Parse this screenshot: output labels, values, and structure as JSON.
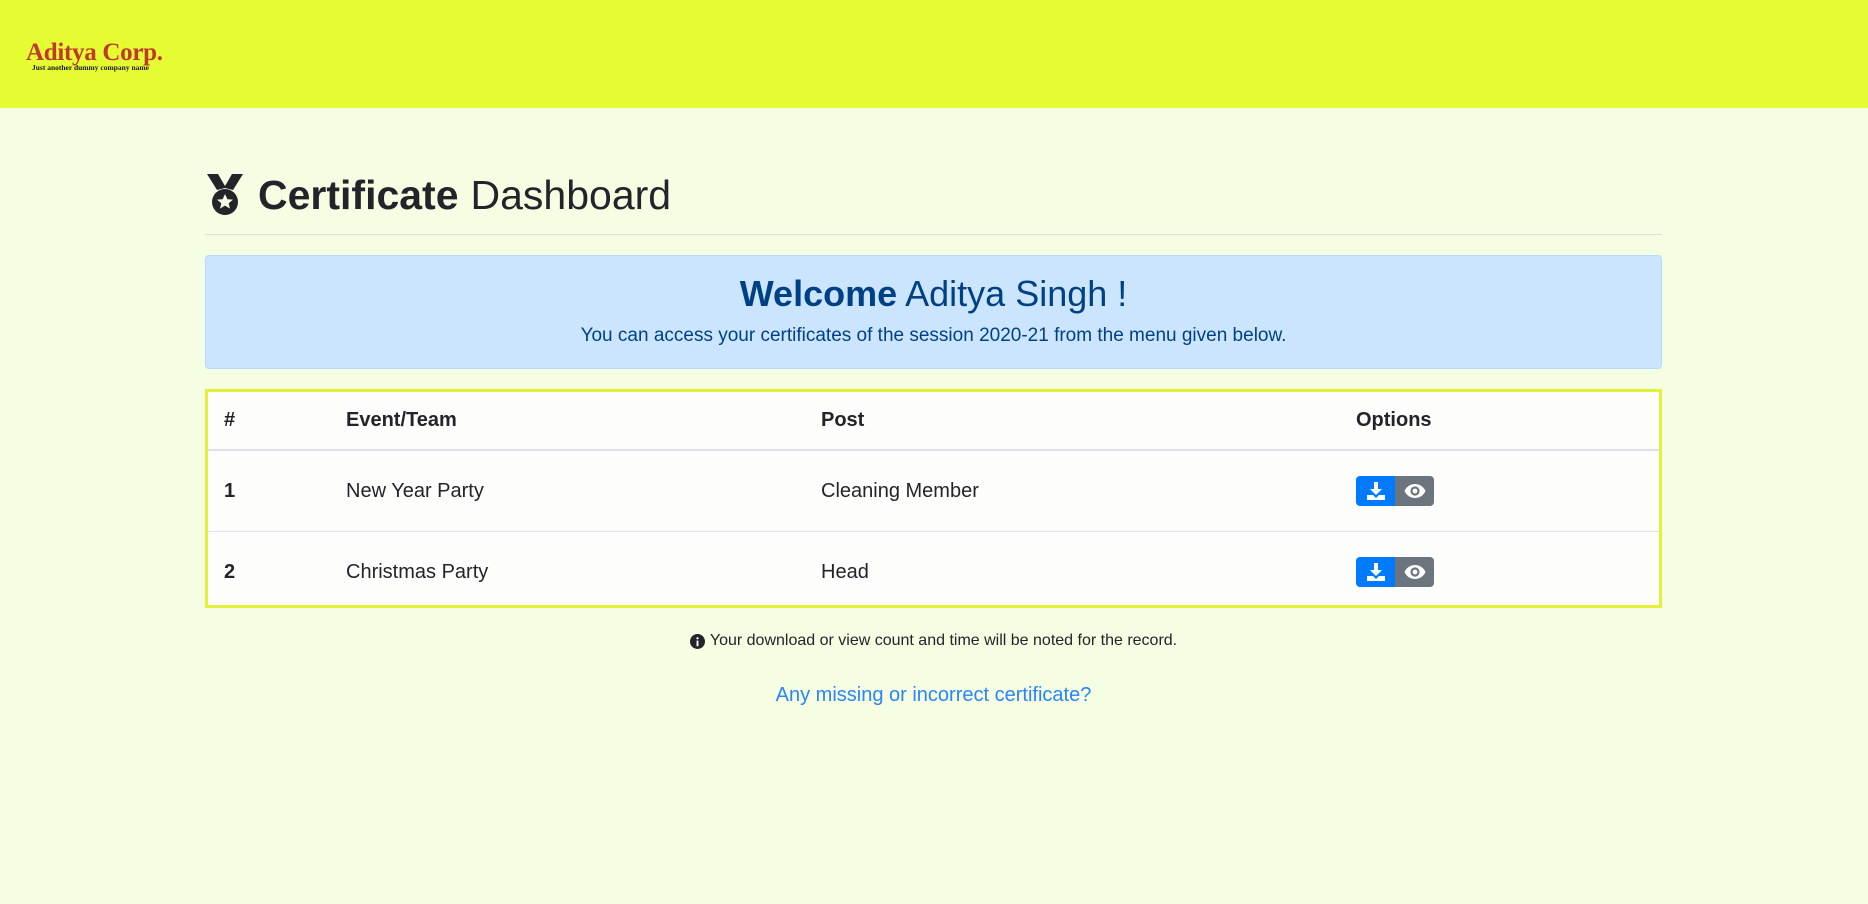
{
  "brand": {
    "name": "Aditya Corp.",
    "tagline": "Just another dummy company name"
  },
  "page": {
    "title_bold": "Certificate",
    "title_rest": "Dashboard",
    "icon": "medal-icon"
  },
  "welcome": {
    "greeting": "Welcome",
    "user_name": "Aditya Singh !",
    "message": "You can access your certificates of the session 2020-21 from the menu given below."
  },
  "table": {
    "headers": [
      "#",
      "Event/Team",
      "Post",
      "Options"
    ],
    "rows": [
      {
        "num": "1",
        "event": "New Year Party",
        "post": "Cleaning Member"
      },
      {
        "num": "2",
        "event": "Christmas Party",
        "post": "Head"
      }
    ],
    "option_icons": [
      "download-icon",
      "eye-icon"
    ]
  },
  "note": {
    "icon": "info-icon",
    "text": "Your download or view count and time will be noted for the record."
  },
  "help_link": "Any missing or incorrect certificate?",
  "colors": {
    "header_bg": "#e5fb32",
    "page_bg": "#f5fde3",
    "alert_bg": "#cce5ff",
    "primary": "#007bff",
    "secondary": "#6c757d",
    "brand": "#c0392b"
  }
}
